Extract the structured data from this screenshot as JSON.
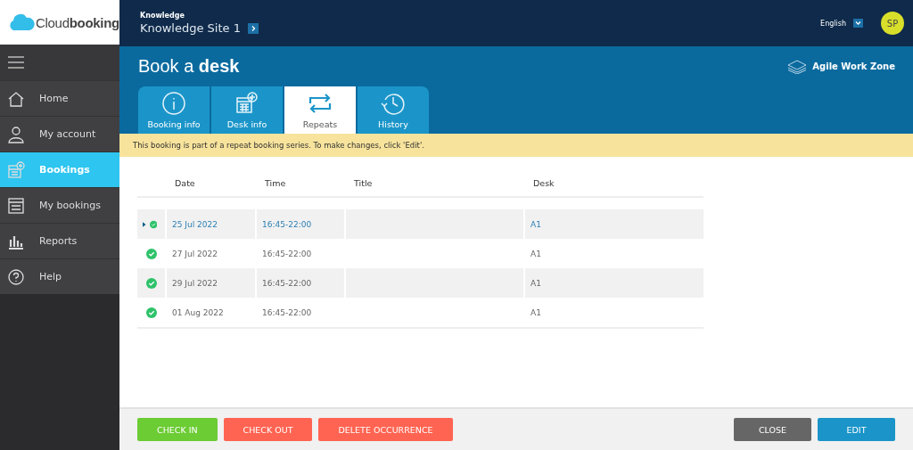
{
  "logo": "Cloud**booking**",
  "header": {
    "site_label": "Knowledge",
    "site_name": "Knowledge Site 1",
    "language": "English",
    "avatar": "SP"
  },
  "sidebar": {
    "items": [
      {
        "label": "Home",
        "selected": false
      },
      {
        "label": "My account",
        "selected": false
      },
      {
        "label": "Bookings",
        "selected": true
      },
      {
        "label": "My bookings",
        "selected": false
      },
      {
        "label": "Reports",
        "selected": false
      },
      {
        "label": "Help",
        "selected": false
      }
    ]
  },
  "page": {
    "title": "Book a **desk**",
    "zone": "Agile Work Zone"
  },
  "tabs": [
    {
      "label": "Booking info",
      "selected": false
    },
    {
      "label": "Desk info",
      "selected": false
    },
    {
      "label": "Repeats",
      "selected": true
    },
    {
      "label": "History",
      "selected": false
    }
  ],
  "notice": "This booking is part of a repeat booking series. To make changes, click 'Edit'.",
  "table": {
    "columns": [
      "Date",
      "Time",
      "Title",
      "Desk"
    ],
    "rows": [
      {
        "date": "25 Jul 2022",
        "time": "16:45-22:00",
        "desk": "A1",
        "selected": true,
        "confirmed": true
      },
      {
        "date": "27 Jul 2022",
        "time": "16:45-22:00",
        "desk": "A1",
        "selected": false,
        "confirmed": true
      },
      {
        "date": "29 Jul 2022",
        "time": "16:45-22:00",
        "desk": "A1",
        "selected": false,
        "confirmed": true
      },
      {
        "date": "01 Aug 2022",
        "time": "16:45-22:00",
        "desk": "A1",
        "selected": false,
        "confirmed": true
      }
    ]
  },
  "footer": {
    "left_buttons": [
      {
        "label": "CHECK IN",
        "kind": "success"
      },
      {
        "label": "CHECK OUT",
        "kind": "danger"
      },
      {
        "label": "DELETE OCCURRENCE",
        "kind": "danger"
      }
    ],
    "right_buttons": [
      {
        "label": "CLOSE",
        "kind": "neutral"
      },
      {
        "label": "EDIT",
        "kind": "primary"
      }
    ]
  }
}
